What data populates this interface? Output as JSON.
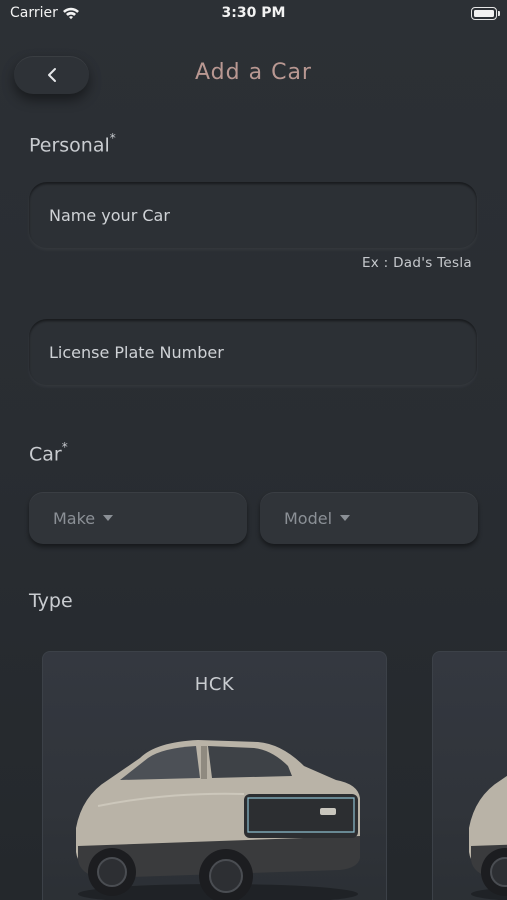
{
  "status_bar": {
    "carrier": "Carrier",
    "time": "3:30 PM"
  },
  "header": {
    "title": "Add a Car",
    "back_icon": "chevron-left-icon"
  },
  "personal": {
    "label": "Personal",
    "required_mark": "*",
    "car_name": {
      "placeholder": "Name your Car",
      "value": "",
      "hint": "Ex : Dad's Tesla"
    },
    "license_plate": {
      "placeholder": "License Plate Number",
      "value": ""
    }
  },
  "car": {
    "label": "Car",
    "required_mark": "*",
    "make": {
      "label": "Make",
      "icon": "caret-down-icon"
    },
    "model": {
      "label": "Model",
      "icon": "caret-down-icon"
    }
  },
  "type": {
    "label": "Type",
    "cards": [
      {
        "label": "HCK",
        "image": "suv-car-image"
      },
      {
        "label": "",
        "image": "suv-car-image"
      }
    ]
  },
  "colors": {
    "background": "#2a2e33",
    "title": "#b99892",
    "text": "#d3d6da",
    "muted": "#8b9096"
  }
}
